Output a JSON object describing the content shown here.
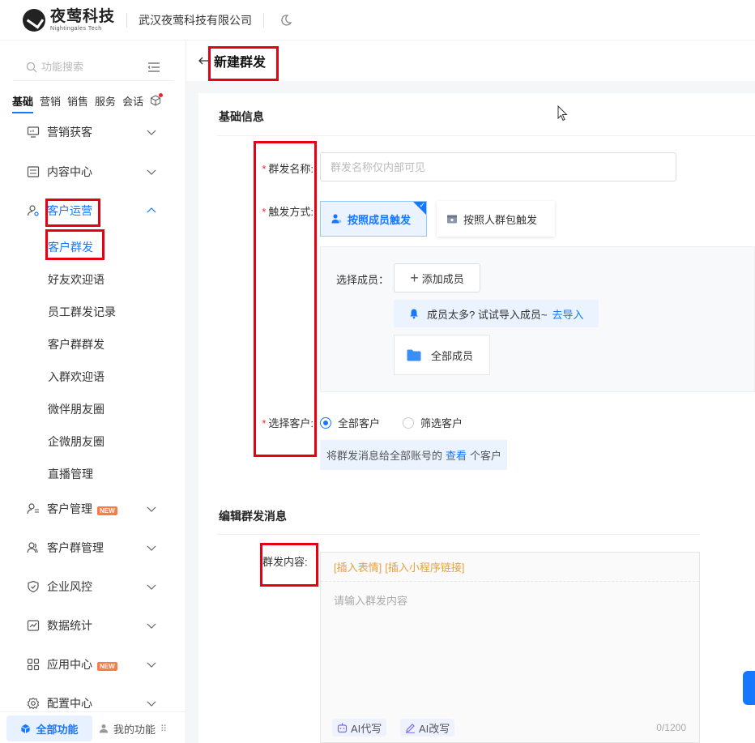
{
  "header": {
    "logo_cn": "夜莺科技",
    "logo_en": "Nightingales Tech",
    "company": "武汉夜莺科技有限公司"
  },
  "sidebar": {
    "search_placeholder": "功能搜索",
    "tabs": [
      "基础",
      "营销",
      "销售",
      "服务",
      "会话"
    ],
    "menu": [
      {
        "label": "营销获客"
      },
      {
        "label": "内容中心"
      },
      {
        "label": "客户运营"
      },
      {
        "label": "客户管理",
        "badge": "NEW"
      },
      {
        "label": "客户群管理"
      },
      {
        "label": "企业风控"
      },
      {
        "label": "数据统计"
      },
      {
        "label": "应用中心",
        "badge": "NEW"
      },
      {
        "label": "配置中心"
      }
    ],
    "submenu": [
      "客户群发",
      "好友欢迎语",
      "员工群发记录",
      "客户群群发",
      "入群欢迎语",
      "微伴朋友圈",
      "企微朋友圈",
      "直播管理"
    ],
    "all_functions": "全部功能",
    "my_functions": "我的功能"
  },
  "page": {
    "title": "新建群发",
    "section_basic": "基础信息",
    "section_edit": "编辑群发消息"
  },
  "form": {
    "name_label": "群发名称:",
    "name_placeholder": "群发名称仅内部可见",
    "trigger_label": "触发方式:",
    "trigger_by_member": "按照成员触发",
    "trigger_by_group": "按照人群包触发",
    "select_member_label": "选择成员：",
    "add_member": "添加成员",
    "tip_text": "成员太多? 试试导入成员~",
    "tip_link": "去导入",
    "all_members": "全部成员",
    "customer_label": "选择客户:",
    "radio_all": "全部客户",
    "radio_filter": "筛选客户",
    "cust_tip_pre": "将群发消息给全部账号的",
    "cust_tip_link": "查看",
    "cust_tip_post": "个客户",
    "content_label": "群发内容:",
    "insert_emoji": "[插入表情]",
    "insert_miniapp": "[插入小程序链接]",
    "content_placeholder": "请输入群发内容",
    "ai_write": "AI代写",
    "ai_rewrite": "AI改写",
    "counter": "0/1200"
  },
  "colors": {
    "accent": "#1677ff",
    "highlight": "#e60012",
    "new_badge": "#ff7a45"
  }
}
